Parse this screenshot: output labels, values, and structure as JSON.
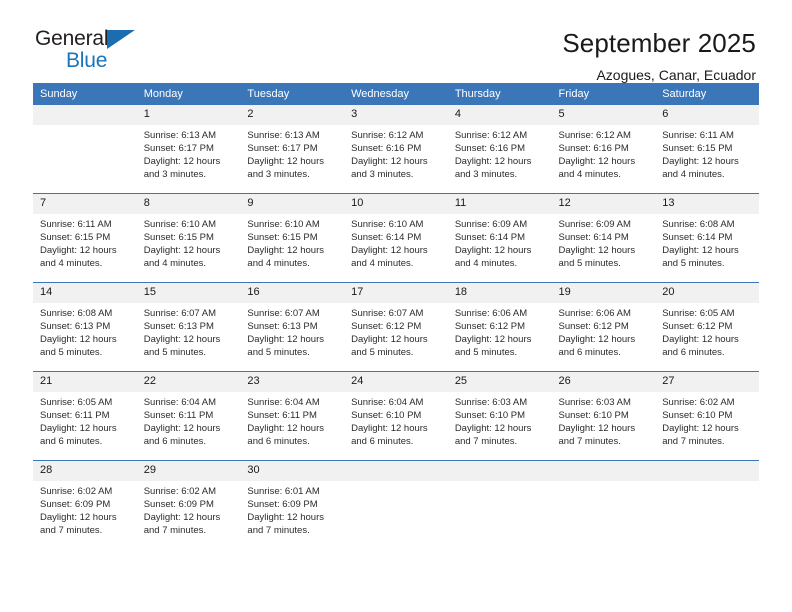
{
  "logo": {
    "line1": "General",
    "line2": "Blue",
    "triangle_color": "#1b6cb0",
    "blue_text_color": "#1b75bb"
  },
  "header": {
    "title": "September 2025",
    "subtitle": "Azogues, Canar, Ecuador"
  },
  "theme": {
    "header_blue": "#3a76b8",
    "daynum_gray": "#f1f1f1"
  },
  "weekdays": [
    "Sunday",
    "Monday",
    "Tuesday",
    "Wednesday",
    "Thursday",
    "Friday",
    "Saturday"
  ],
  "weeks": [
    [
      {
        "day": "",
        "sunrise": "",
        "sunset": "",
        "daylight1": "",
        "daylight2": ""
      },
      {
        "day": "1",
        "sunrise": "Sunrise: 6:13 AM",
        "sunset": "Sunset: 6:17 PM",
        "daylight1": "Daylight: 12 hours",
        "daylight2": "and 3 minutes."
      },
      {
        "day": "2",
        "sunrise": "Sunrise: 6:13 AM",
        "sunset": "Sunset: 6:17 PM",
        "daylight1": "Daylight: 12 hours",
        "daylight2": "and 3 minutes."
      },
      {
        "day": "3",
        "sunrise": "Sunrise: 6:12 AM",
        "sunset": "Sunset: 6:16 PM",
        "daylight1": "Daylight: 12 hours",
        "daylight2": "and 3 minutes."
      },
      {
        "day": "4",
        "sunrise": "Sunrise: 6:12 AM",
        "sunset": "Sunset: 6:16 PM",
        "daylight1": "Daylight: 12 hours",
        "daylight2": "and 3 minutes."
      },
      {
        "day": "5",
        "sunrise": "Sunrise: 6:12 AM",
        "sunset": "Sunset: 6:16 PM",
        "daylight1": "Daylight: 12 hours",
        "daylight2": "and 4 minutes."
      },
      {
        "day": "6",
        "sunrise": "Sunrise: 6:11 AM",
        "sunset": "Sunset: 6:15 PM",
        "daylight1": "Daylight: 12 hours",
        "daylight2": "and 4 minutes."
      }
    ],
    [
      {
        "day": "7",
        "sunrise": "Sunrise: 6:11 AM",
        "sunset": "Sunset: 6:15 PM",
        "daylight1": "Daylight: 12 hours",
        "daylight2": "and 4 minutes."
      },
      {
        "day": "8",
        "sunrise": "Sunrise: 6:10 AM",
        "sunset": "Sunset: 6:15 PM",
        "daylight1": "Daylight: 12 hours",
        "daylight2": "and 4 minutes."
      },
      {
        "day": "9",
        "sunrise": "Sunrise: 6:10 AM",
        "sunset": "Sunset: 6:15 PM",
        "daylight1": "Daylight: 12 hours",
        "daylight2": "and 4 minutes."
      },
      {
        "day": "10",
        "sunrise": "Sunrise: 6:10 AM",
        "sunset": "Sunset: 6:14 PM",
        "daylight1": "Daylight: 12 hours",
        "daylight2": "and 4 minutes."
      },
      {
        "day": "11",
        "sunrise": "Sunrise: 6:09 AM",
        "sunset": "Sunset: 6:14 PM",
        "daylight1": "Daylight: 12 hours",
        "daylight2": "and 4 minutes."
      },
      {
        "day": "12",
        "sunrise": "Sunrise: 6:09 AM",
        "sunset": "Sunset: 6:14 PM",
        "daylight1": "Daylight: 12 hours",
        "daylight2": "and 5 minutes."
      },
      {
        "day": "13",
        "sunrise": "Sunrise: 6:08 AM",
        "sunset": "Sunset: 6:14 PM",
        "daylight1": "Daylight: 12 hours",
        "daylight2": "and 5 minutes."
      }
    ],
    [
      {
        "day": "14",
        "sunrise": "Sunrise: 6:08 AM",
        "sunset": "Sunset: 6:13 PM",
        "daylight1": "Daylight: 12 hours",
        "daylight2": "and 5 minutes."
      },
      {
        "day": "15",
        "sunrise": "Sunrise: 6:07 AM",
        "sunset": "Sunset: 6:13 PM",
        "daylight1": "Daylight: 12 hours",
        "daylight2": "and 5 minutes."
      },
      {
        "day": "16",
        "sunrise": "Sunrise: 6:07 AM",
        "sunset": "Sunset: 6:13 PM",
        "daylight1": "Daylight: 12 hours",
        "daylight2": "and 5 minutes."
      },
      {
        "day": "17",
        "sunrise": "Sunrise: 6:07 AM",
        "sunset": "Sunset: 6:12 PM",
        "daylight1": "Daylight: 12 hours",
        "daylight2": "and 5 minutes."
      },
      {
        "day": "18",
        "sunrise": "Sunrise: 6:06 AM",
        "sunset": "Sunset: 6:12 PM",
        "daylight1": "Daylight: 12 hours",
        "daylight2": "and 5 minutes."
      },
      {
        "day": "19",
        "sunrise": "Sunrise: 6:06 AM",
        "sunset": "Sunset: 6:12 PM",
        "daylight1": "Daylight: 12 hours",
        "daylight2": "and 6 minutes."
      },
      {
        "day": "20",
        "sunrise": "Sunrise: 6:05 AM",
        "sunset": "Sunset: 6:12 PM",
        "daylight1": "Daylight: 12 hours",
        "daylight2": "and 6 minutes."
      }
    ],
    [
      {
        "day": "21",
        "sunrise": "Sunrise: 6:05 AM",
        "sunset": "Sunset: 6:11 PM",
        "daylight1": "Daylight: 12 hours",
        "daylight2": "and 6 minutes."
      },
      {
        "day": "22",
        "sunrise": "Sunrise: 6:04 AM",
        "sunset": "Sunset: 6:11 PM",
        "daylight1": "Daylight: 12 hours",
        "daylight2": "and 6 minutes."
      },
      {
        "day": "23",
        "sunrise": "Sunrise: 6:04 AM",
        "sunset": "Sunset: 6:11 PM",
        "daylight1": "Daylight: 12 hours",
        "daylight2": "and 6 minutes."
      },
      {
        "day": "24",
        "sunrise": "Sunrise: 6:04 AM",
        "sunset": "Sunset: 6:10 PM",
        "daylight1": "Daylight: 12 hours",
        "daylight2": "and 6 minutes."
      },
      {
        "day": "25",
        "sunrise": "Sunrise: 6:03 AM",
        "sunset": "Sunset: 6:10 PM",
        "daylight1": "Daylight: 12 hours",
        "daylight2": "and 7 minutes."
      },
      {
        "day": "26",
        "sunrise": "Sunrise: 6:03 AM",
        "sunset": "Sunset: 6:10 PM",
        "daylight1": "Daylight: 12 hours",
        "daylight2": "and 7 minutes."
      },
      {
        "day": "27",
        "sunrise": "Sunrise: 6:02 AM",
        "sunset": "Sunset: 6:10 PM",
        "daylight1": "Daylight: 12 hours",
        "daylight2": "and 7 minutes."
      }
    ],
    [
      {
        "day": "28",
        "sunrise": "Sunrise: 6:02 AM",
        "sunset": "Sunset: 6:09 PM",
        "daylight1": "Daylight: 12 hours",
        "daylight2": "and 7 minutes."
      },
      {
        "day": "29",
        "sunrise": "Sunrise: 6:02 AM",
        "sunset": "Sunset: 6:09 PM",
        "daylight1": "Daylight: 12 hours",
        "daylight2": "and 7 minutes."
      },
      {
        "day": "30",
        "sunrise": "Sunrise: 6:01 AM",
        "sunset": "Sunset: 6:09 PM",
        "daylight1": "Daylight: 12 hours",
        "daylight2": "and 7 minutes."
      },
      {
        "day": "",
        "sunrise": "",
        "sunset": "",
        "daylight1": "",
        "daylight2": ""
      },
      {
        "day": "",
        "sunrise": "",
        "sunset": "",
        "daylight1": "",
        "daylight2": ""
      },
      {
        "day": "",
        "sunrise": "",
        "sunset": "",
        "daylight1": "",
        "daylight2": ""
      },
      {
        "day": "",
        "sunrise": "",
        "sunset": "",
        "daylight1": "",
        "daylight2": ""
      }
    ]
  ]
}
